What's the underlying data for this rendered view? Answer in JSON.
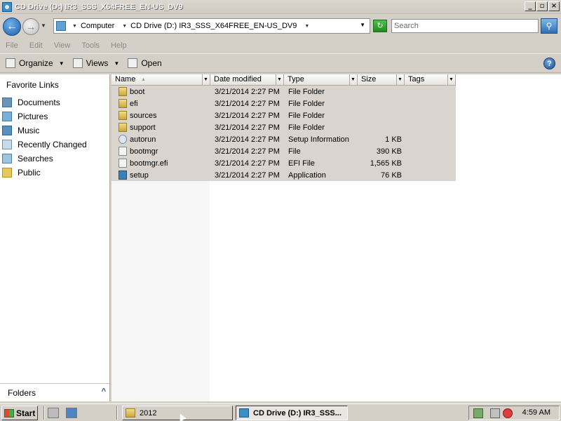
{
  "window": {
    "title": "CD Drive (D:) IR3_SSS_X64FREE_EN-US_DV9",
    "buttons": {
      "minimize": "_",
      "maximize": "▫",
      "close": "×"
    }
  },
  "address": {
    "segments": [
      "Computer",
      "CD Drive (D:) IR3_SSS_X64FREE_EN-US_DV9"
    ],
    "search_placeholder": "Search"
  },
  "menu": [
    "File",
    "Edit",
    "View",
    "Tools",
    "Help"
  ],
  "toolbar": {
    "organize": "Organize",
    "views": "Views",
    "open": "Open",
    "help": "?"
  },
  "nav": {
    "heading": "Favorite Links",
    "items": [
      "Documents",
      "Pictures",
      "Music",
      "Recently Changed",
      "Searches",
      "Public"
    ],
    "folders_label": "Folders",
    "folders_toggle": "^"
  },
  "columns": [
    "Name",
    "Date modified",
    "Type",
    "Size",
    "Tags"
  ],
  "files": [
    {
      "name": "boot",
      "date": "3/21/2014 2:27 PM",
      "type": "File Folder",
      "size": "",
      "icon": "folder-icon"
    },
    {
      "name": "efi",
      "date": "3/21/2014 2:27 PM",
      "type": "File Folder",
      "size": "",
      "icon": "folder-icon"
    },
    {
      "name": "sources",
      "date": "3/21/2014 2:27 PM",
      "type": "File Folder",
      "size": "",
      "icon": "folder-icon"
    },
    {
      "name": "support",
      "date": "3/21/2014 2:27 PM",
      "type": "File Folder",
      "size": "",
      "icon": "folder-icon"
    },
    {
      "name": "autorun",
      "date": "3/21/2014 2:27 PM",
      "type": "Setup Information",
      "size": "1 KB",
      "icon": "setup-info-icon"
    },
    {
      "name": "bootmgr",
      "date": "3/21/2014 2:27 PM",
      "type": "File",
      "size": "390 KB",
      "icon": "file-icon"
    },
    {
      "name": "bootmgr.efi",
      "date": "3/21/2014 2:27 PM",
      "type": "EFI File",
      "size": "1,565 KB",
      "icon": "file-icon"
    },
    {
      "name": "setup",
      "date": "3/21/2014 2:27 PM",
      "type": "Application",
      "size": "76 KB",
      "icon": "application-icon"
    }
  ],
  "taskbar": {
    "start": "Start",
    "tasks": [
      "2012",
      "CD Drive (D:) IR3_SSS..."
    ],
    "clock": "4:59 AM"
  }
}
